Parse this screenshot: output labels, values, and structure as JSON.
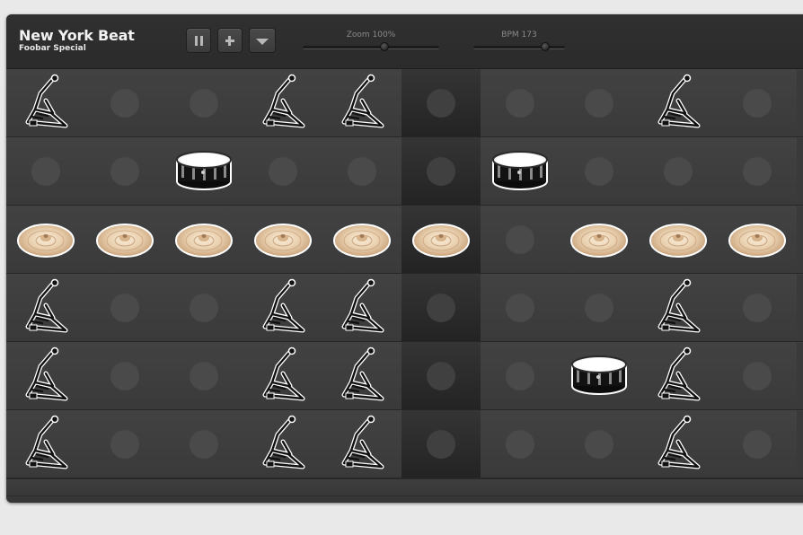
{
  "song": {
    "title": "New York Beat",
    "subtitle": "Foobar Special"
  },
  "toolbar": {
    "buttons": [
      {
        "name": "pause",
        "icon": "pause-icon"
      },
      {
        "name": "add",
        "icon": "plus-icon"
      },
      {
        "name": "menu",
        "icon": "chevron-down-icon"
      }
    ]
  },
  "zoom": {
    "label": "Zoom 100%",
    "value": 0.6
  },
  "bpm": {
    "label": "BPM 173",
    "value": 0.78
  },
  "colors": {
    "background": "#3a3a3a",
    "header": "#2e2e2e",
    "accent_column": "#2a2a2a"
  },
  "highlight_step": 5,
  "pattern": [
    [
      "pedal",
      "",
      "",
      "pedal",
      "pedal",
      "",
      "",
      "",
      "pedal",
      ""
    ],
    [
      "",
      "",
      "snare",
      "",
      "",
      "",
      "snare",
      "",
      "",
      ""
    ],
    [
      "cymbal",
      "cymbal",
      "cymbal",
      "cymbal",
      "cymbal",
      "cymbal",
      "",
      "cymbal",
      "cymbal",
      "cymbal"
    ],
    [
      "pedal",
      "",
      "",
      "pedal",
      "pedal",
      "",
      "",
      "",
      "pedal",
      ""
    ],
    [
      "pedal",
      "",
      "",
      "pedal",
      "pedal",
      "",
      "",
      "snare",
      "pedal",
      ""
    ],
    [
      "pedal",
      "",
      "",
      "pedal",
      "pedal",
      "",
      "",
      "",
      "pedal",
      ""
    ]
  ]
}
